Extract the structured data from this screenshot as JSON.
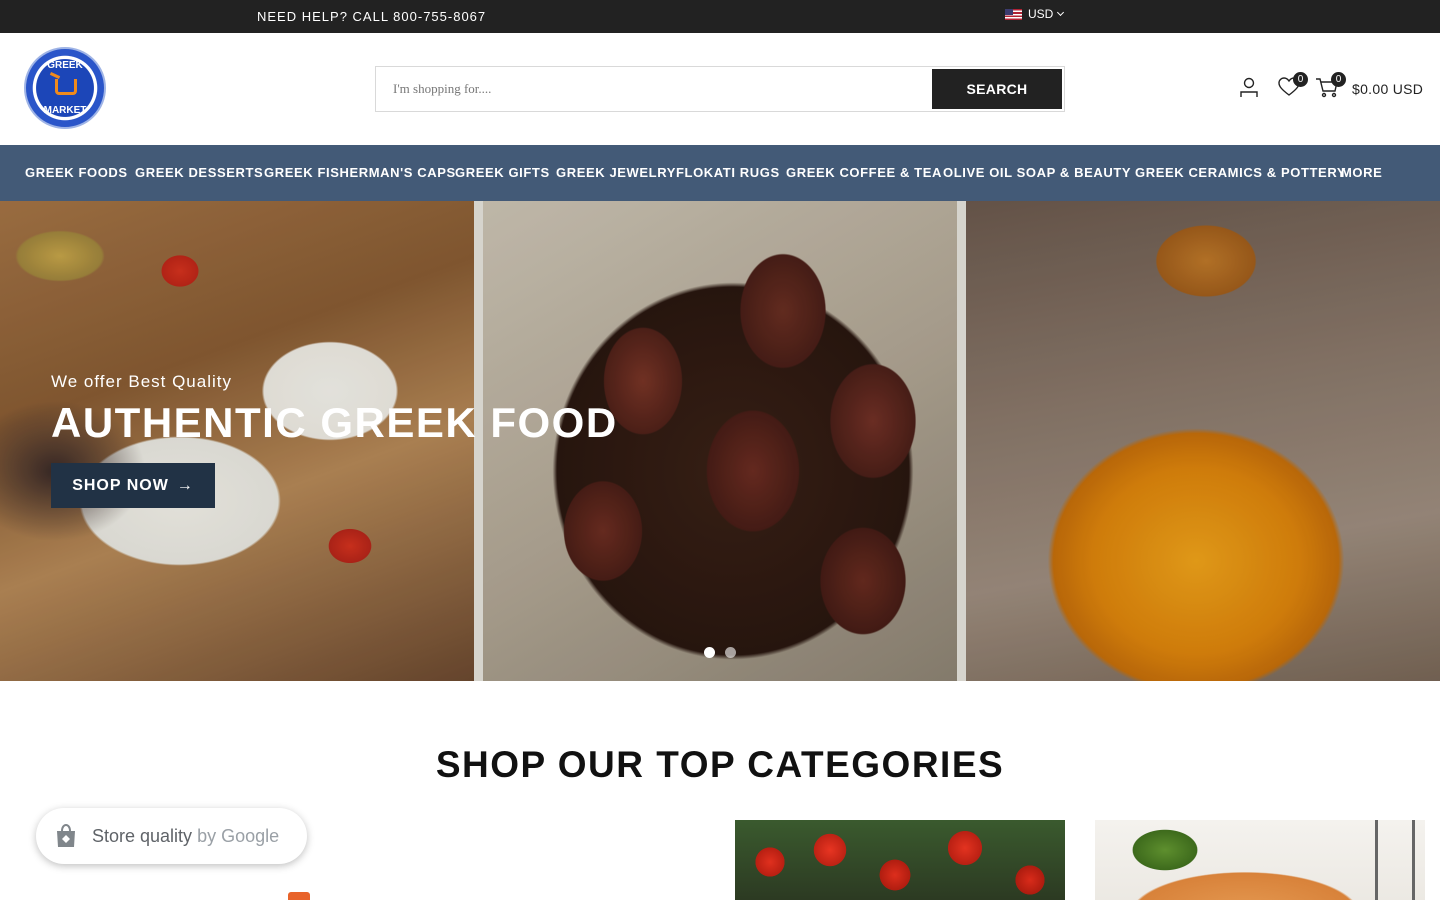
{
  "topbar": {
    "help_text": "NEED HELP? CALL 800-755-8067",
    "currency": "USD"
  },
  "header": {
    "logo_text_top": "GREEK",
    "logo_text_bottom": "MARKET",
    "search_placeholder": "I'm shopping for....",
    "search_button": "SEARCH",
    "wishlist_count": "0",
    "cart_count": "0",
    "cart_total": "$0.00 USD"
  },
  "nav": {
    "items": [
      "GREEK FOODS",
      "GREEK DESSERTS",
      "GREEK FISHERMAN'S CAPS",
      "GREEK GIFTS",
      "GREEK JEWELRY",
      "FLOKATI RUGS",
      "GREEK COFFEE & TEA",
      "OLIVE OIL SOAP & BEAUTY",
      "GREEK CERAMICS & POTTERY",
      "MORE"
    ]
  },
  "hero": {
    "subtitle": "We offer Best Quality",
    "title": "AUTHENTIC GREEK FOOD",
    "button": "SHOP NOW",
    "button_arrow": "→",
    "active_slide": 1,
    "slide_count": 2
  },
  "section": {
    "title": "SHOP OUR TOP CATEGORIES"
  },
  "store_badge": {
    "label": "Store quality",
    "by": "by Google"
  },
  "colors": {
    "topbar": "#222222",
    "nav": "#435a77",
    "hero_button": "#213245",
    "search_button": "#222222"
  }
}
